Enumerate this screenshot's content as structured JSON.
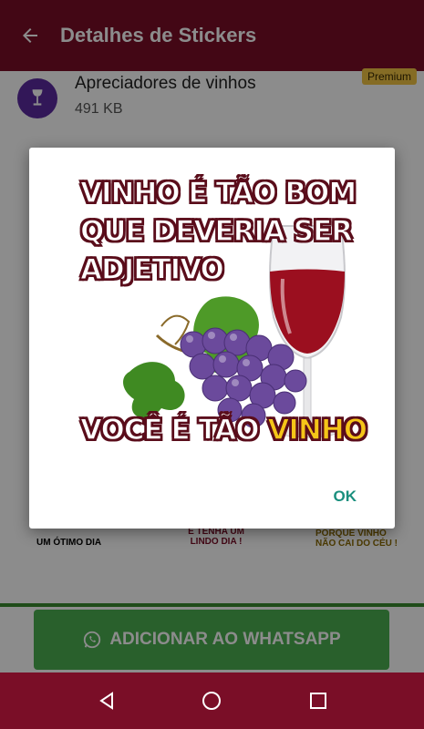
{
  "appbar": {
    "title": "Detalhes de Stickers"
  },
  "pack": {
    "name": "Apreciadores de vinhos",
    "size": "491 KB",
    "badge": "Premium"
  },
  "grid_labels": [
    "UM ÓTIMO DIA",
    "E TENHA UM LINDO DIA !",
    "PORQUE VINHO NÃO CAI DO CÉU !"
  ],
  "dialog": {
    "sticker_lines": [
      "VINHO É TÃO BOM",
      "QUE DEVERIA SER",
      "ADJETIVO"
    ],
    "sticker_bottom": "VOCÊ É TÃO ",
    "sticker_highlight": "VINHO",
    "ok_label": "OK"
  },
  "action": {
    "add_label": "ADICIONAR AO WHATSAPP"
  },
  "colors": {
    "primary": "#7a0e27",
    "whatsapp_green": "#4caf50",
    "dialog_ok": "#1a8f7e",
    "premium": "#f3c544"
  }
}
